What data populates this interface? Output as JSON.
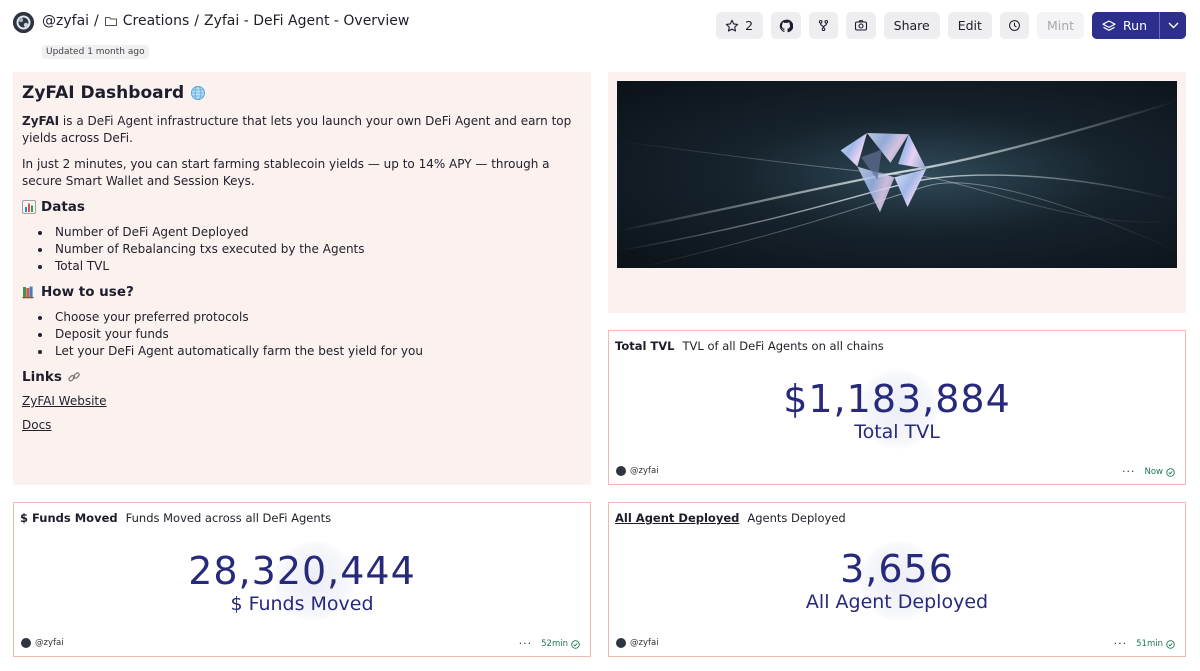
{
  "header": {
    "owner": "@zyfai",
    "separator": "/",
    "folder": "Creations",
    "title": "Zyfai - DeFi Agent - Overview",
    "updated_prefix": "Updated",
    "updated_value": "1 month ago"
  },
  "toolbar": {
    "star_count": "2",
    "share_label": "Share",
    "edit_label": "Edit",
    "mint_label": "Mint",
    "run_label": "Run"
  },
  "text_panel": {
    "title": "ZyFAI Dashboard",
    "intro_bold": "ZyFAI",
    "intro_rest": " is a DeFi Agent infrastructure that lets you launch your own DeFi Agent and earn top yields across DeFi.",
    "para2": "In just 2 minutes, you can start farming stablecoin yields — up to 14% APY — through a secure Smart Wallet and Session Keys.",
    "datas_heading": "Datas",
    "datas_items": [
      "Number of DeFi Agent Deployed",
      "Number of Rebalancing txs executed by the Agents",
      "Total TVL"
    ],
    "howto_heading": "How to use?",
    "howto_items": [
      "Choose your preferred protocols",
      "Deposit your funds",
      "Let your DeFi Agent automatically farm the best yield for you"
    ],
    "links_heading": "Links",
    "link_website": "ZyFAI Website",
    "link_docs": "Docs"
  },
  "counters": {
    "tvl": {
      "name": "Total TVL",
      "desc": "TVL of all DeFi Agents on all chains",
      "value": "$1,183,884",
      "label": "Total TVL",
      "author": "@zyfai",
      "freshness": "Now"
    },
    "funds": {
      "name": "$ Funds Moved",
      "desc": "Funds Moved across all DeFi Agents",
      "value": "28,320,444",
      "label": "$ Funds Moved",
      "author": "@zyfai",
      "freshness": "52min"
    },
    "agents": {
      "name": "All Agent Deployed",
      "desc": "Agents Deployed",
      "value": "3,656",
      "label": "All Agent Deployed",
      "author": "@zyfai",
      "freshness": "51min"
    }
  },
  "icons": {
    "star": "star-icon",
    "github": "github-icon",
    "fork": "fork-icon",
    "screenshot": "camera-icon",
    "schedule": "clock-icon",
    "run": "run-layers-icon",
    "caret": "chevron-down-icon",
    "folder": "folder-icon",
    "check": "check-circle-icon"
  },
  "colors": {
    "accent": "#2d2f8d",
    "counter_value": "#272a7a",
    "panel_bg": "#fbf1ef",
    "panel_border": "#f0b9b2",
    "status_green": "#1e7a4e"
  }
}
